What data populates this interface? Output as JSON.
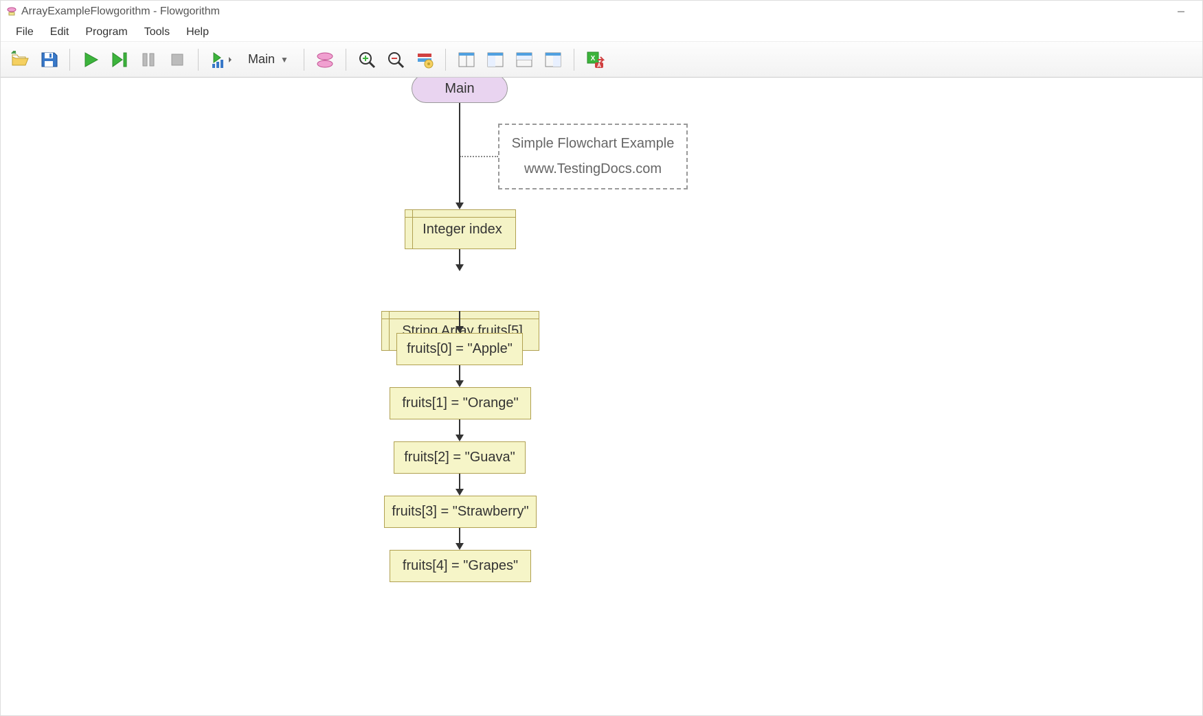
{
  "window": {
    "title": "ArrayExampleFlowgorithm - Flowgorithm"
  },
  "menu": {
    "file": "File",
    "edit": "Edit",
    "program": "Program",
    "tools": "Tools",
    "help": "Help"
  },
  "toolbar": {
    "function": "Main"
  },
  "flowchart": {
    "main": "Main",
    "comment_line1": "Simple Flowchart Example",
    "comment_line2": "www.TestingDocs.com",
    "declare1": "Integer index",
    "declare2": "String Array fruits[5]",
    "assign0": "fruits[0] = \"Apple\"",
    "assign1": "fruits[1] = \"Orange\"",
    "assign2": "fruits[2] = \"Guava\"",
    "assign3": "fruits[3] = \"Strawberry\"",
    "assign4": "fruits[4] = \"Grapes\""
  }
}
